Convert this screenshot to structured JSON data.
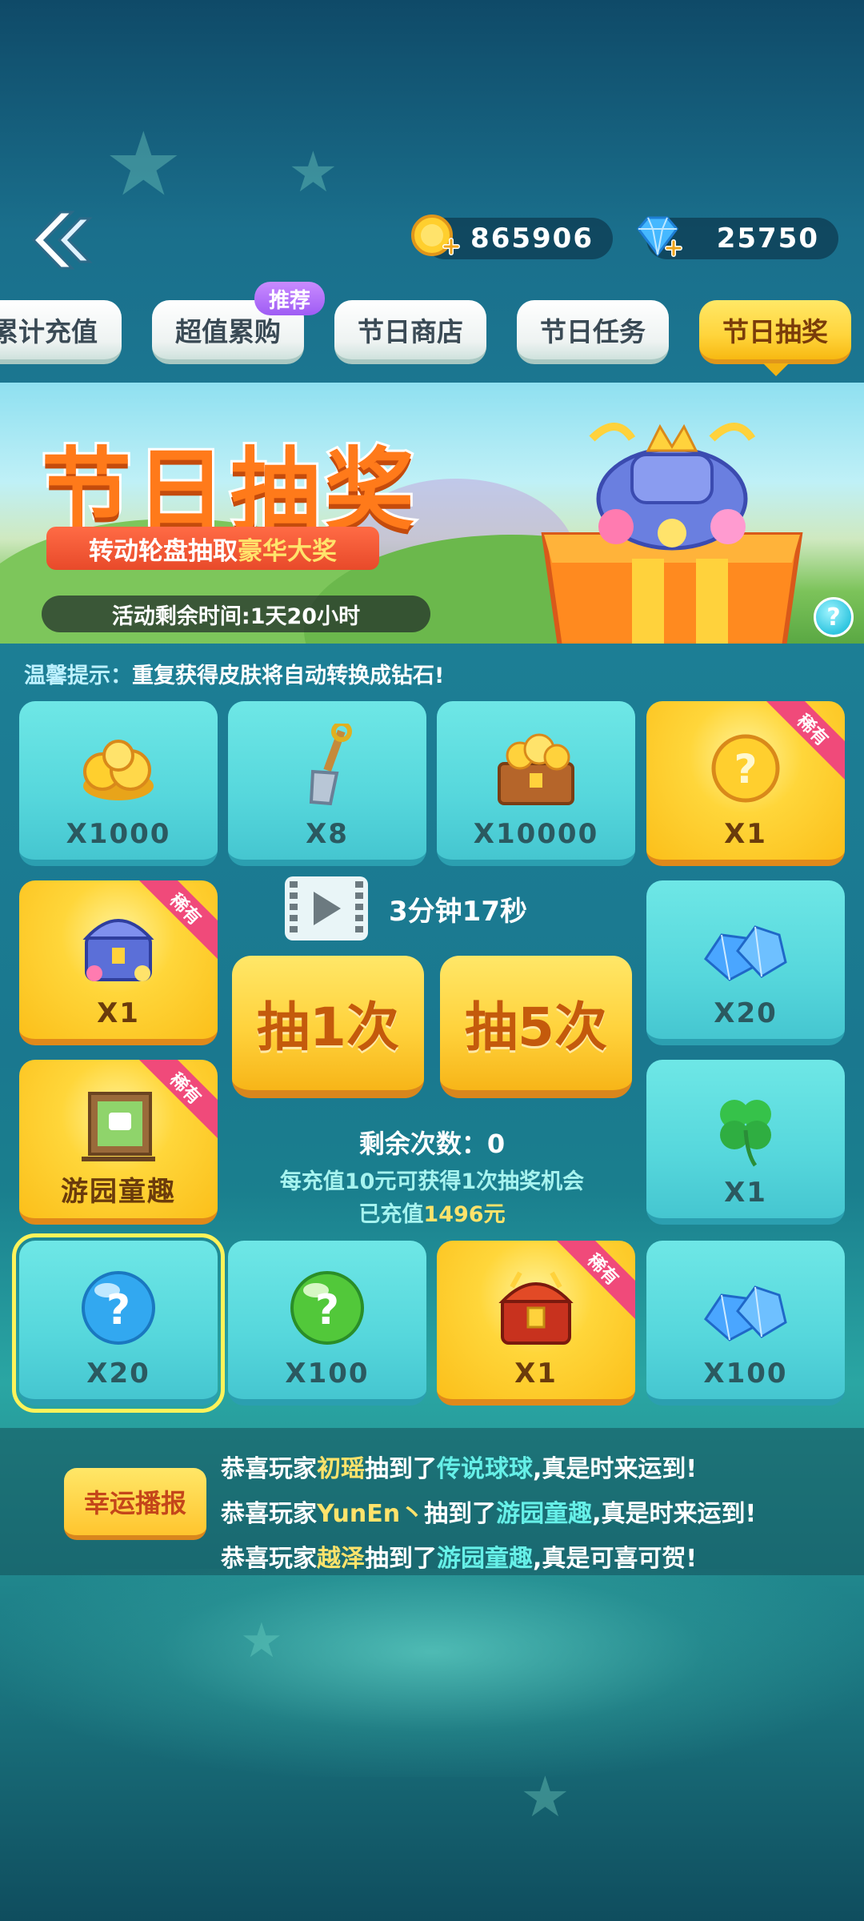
{
  "top_bar": {
    "coins": "865906",
    "diamonds": "25750",
    "back_icon": "double-chevron-left-icon"
  },
  "tabs": [
    {
      "label": "累计充值"
    },
    {
      "label": "超值累购",
      "badge": "推荐"
    },
    {
      "label": "节日商店"
    },
    {
      "label": "节日任务"
    },
    {
      "label": "节日抽奖",
      "active": true
    }
  ],
  "banner": {
    "title": "节日抽奖",
    "subtitle_prefix": "转动轮盘抽取",
    "subtitle_highlight": "豪华大奖",
    "timer": "活动剩余时间:1天20小时",
    "help": "?"
  },
  "tip": {
    "prefix": "温馨提示：",
    "text": "重复获得皮肤将自动转换成钻石!"
  },
  "prizes": [
    {
      "label": "X1000",
      "icon": "gold-coins-icon",
      "rare": false
    },
    {
      "label": "X8",
      "icon": "shovel-icon",
      "rare": false
    },
    {
      "label": "X10000",
      "icon": "coin-chest-icon",
      "rare": false
    },
    {
      "label": "X1",
      "icon": "gold-mystery-orb-icon",
      "rare": true
    },
    {
      "label": "X1",
      "icon": "royal-chest-icon",
      "rare": true
    },
    {
      "label": "X20",
      "icon": "diamond-pile-icon",
      "rare": false
    },
    {
      "label": "游园童趣",
      "icon": "picture-frame-icon",
      "rare": true
    },
    {
      "label": "X1",
      "icon": "clover-icon",
      "rare": false
    },
    {
      "label": "X20",
      "icon": "blue-mystery-ball-icon",
      "rare": false,
      "selected": true
    },
    {
      "label": "X100",
      "icon": "green-mystery-ball-icon",
      "rare": false
    },
    {
      "label": "X1",
      "icon": "dragon-chest-icon",
      "rare": true
    },
    {
      "label": "X100",
      "icon": "diamond-pile-icon",
      "rare": false
    }
  ],
  "rare_tag": "稀有",
  "center": {
    "video_timer": "3分钟17秒",
    "draw_once": "抽1次",
    "draw_five": "抽5次",
    "remaining": "剩余次数：0",
    "recharge_rule": "每充值10元可获得1次抽奖机会",
    "recharged_prefix": "已充值",
    "recharged_amount": "1496元"
  },
  "broadcast": {
    "title": "幸运播报",
    "lines": [
      {
        "pre": "恭喜玩家",
        "player": "初瑶",
        "mid": "抽到了",
        "item": "传说球球",
        "post": ",真是时来运到!"
      },
      {
        "pre": "恭喜玩家",
        "player": "YunEn丶",
        "mid": "抽到了",
        "item": "游园童趣",
        "post": ",真是时来运到!"
      },
      {
        "pre": "恭喜玩家",
        "player": "越泽",
        "mid": "抽到了",
        "item": "游园童趣",
        "post": ",真是可喜可贺!"
      }
    ]
  },
  "colors": {
    "gold": "#ffd23c",
    "teal_tile": "#56d7dc",
    "rare_ribbon": "#f04a7a",
    "highlight_yellow": "#ffe36b",
    "highlight_cyan": "#66f0e8"
  }
}
